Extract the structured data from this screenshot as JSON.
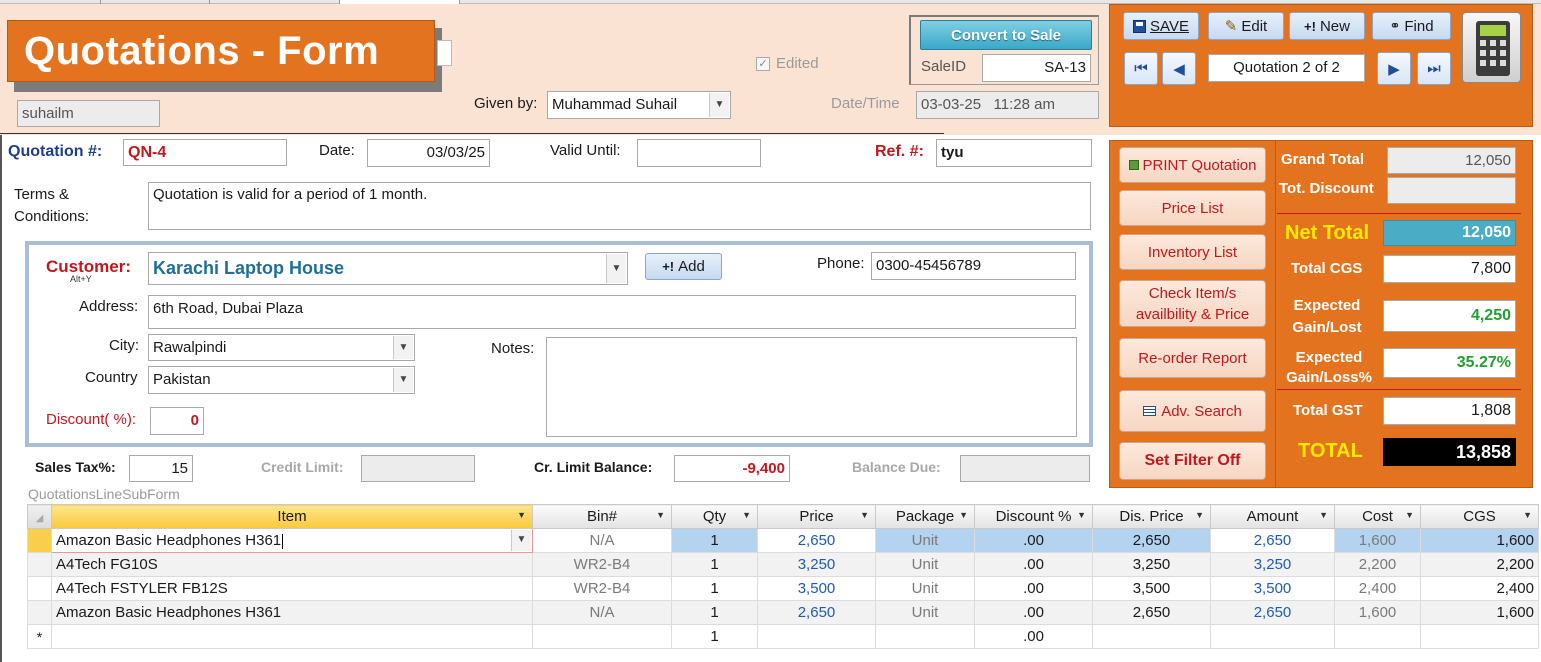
{
  "header": {
    "title": "Quotations - Form",
    "user": "suhailm",
    "edited_label": "Edited",
    "given_by_label": "Given by:",
    "given_by": "Muhammad Suhail",
    "datetime_label": "Date/Time",
    "datetime": "03-03-25   11:28 am",
    "convert_label": "Convert to Sale",
    "saleid_label": "SaleID",
    "saleid": "SA-13"
  },
  "toolbar": {
    "save": "SAVE",
    "edit": "Edit",
    "new": "New",
    "find": "Find",
    "record_status": "Quotation 2 of 2"
  },
  "form": {
    "quotation_no_label": "Quotation #:",
    "quotation_no": "QN-4",
    "date_label": "Date:",
    "date": "03/03/25",
    "valid_until_label": "Valid Until:",
    "valid_until": "",
    "ref_label": "Ref. #:",
    "ref": "tyu",
    "terms_label_1": "Terms &",
    "terms_label_2": "Conditions:",
    "terms": "Quotation is valid for a period of 1 month."
  },
  "customer": {
    "label": "Customer:",
    "shortcut": "Alt+Y",
    "name": "Karachi Laptop House",
    "add_label": "Add",
    "phone_label": "Phone:",
    "phone": "0300-45456789",
    "address_label": "Address:",
    "address": "6th Road, Dubai Plaza",
    "city_label": "City:",
    "city": "Rawalpindi",
    "country_label": "Country",
    "country": "Pakistan",
    "notes_label": "Notes:",
    "notes": "",
    "discount_label": "Discount( %):",
    "discount": "0"
  },
  "summary": {
    "sales_tax_label": "Sales Tax%:",
    "sales_tax": "15",
    "credit_limit_label": "Credit Limit:",
    "credit_limit": "",
    "cr_balance_label": "Cr. Limit Balance:",
    "cr_balance": "-9,400",
    "balance_due_label": "Balance Due:",
    "balance_due": ""
  },
  "side_buttons": {
    "print": "PRINT Quotation",
    "price_list": "Price List",
    "inventory_list": "Inventory List",
    "check_1": "Check Item/s",
    "check_2": "availbility & Price",
    "reorder": "Re-order Report",
    "adv_search": "Adv. Search",
    "filter_off": "Set Filter Off"
  },
  "totals": {
    "grand_total_label": "Grand Total",
    "grand_total": "12,050",
    "tot_discount_label": "Tot. Discount",
    "tot_discount": "",
    "net_total_label": "Net Total",
    "net_total": "12,050",
    "total_cgs_label": "Total CGS",
    "total_cgs": "7,800",
    "gain_label_1": "Expected",
    "gain_label_2": "Gain/Lost",
    "gain": "4,250",
    "gainpct_label_1": "Expected",
    "gainpct_label_2": "Gain/Loss%",
    "gainpct": "35.27%",
    "total_gst_label": "Total GST",
    "total_gst": "1,808",
    "total_label": "TOTAL",
    "total": "13,858"
  },
  "subform": {
    "caption": "QuotationsLineSubForm",
    "columns": [
      "Item",
      "Bin#",
      "Qty",
      "Price",
      "Package",
      "Discount %",
      "Dis. Price",
      "Amount",
      "Cost",
      "CGS"
    ],
    "rows": [
      [
        "Amazon Basic Headphones H361",
        "N/A",
        "1",
        "2,650",
        "Unit",
        ".00",
        "2,650",
        "2,650",
        "1,600",
        "1,600"
      ],
      [
        "A4Tech FG10S",
        "WR2-B4",
        "1",
        "3,250",
        "Unit",
        ".00",
        "3,250",
        "3,250",
        "2,200",
        "2,200"
      ],
      [
        "A4Tech FSTYLER FB12S",
        "WR2-B4",
        "1",
        "3,500",
        "Unit",
        ".00",
        "3,500",
        "3,500",
        "2,400",
        "2,400"
      ],
      [
        "Amazon Basic Headphones H361",
        "N/A",
        "1",
        "2,650",
        "Unit",
        ".00",
        "2,650",
        "2,650",
        "1,600",
        "1,600"
      ]
    ],
    "new_row_marker": "*",
    "new_row_qty": "1",
    "new_row_discount": ".00"
  },
  "colors": {
    "accent_orange": "#e3731f",
    "header_bg": "#fbe3d4",
    "label_red": "#c0181f",
    "net_total_cell": "#4bacc6"
  }
}
